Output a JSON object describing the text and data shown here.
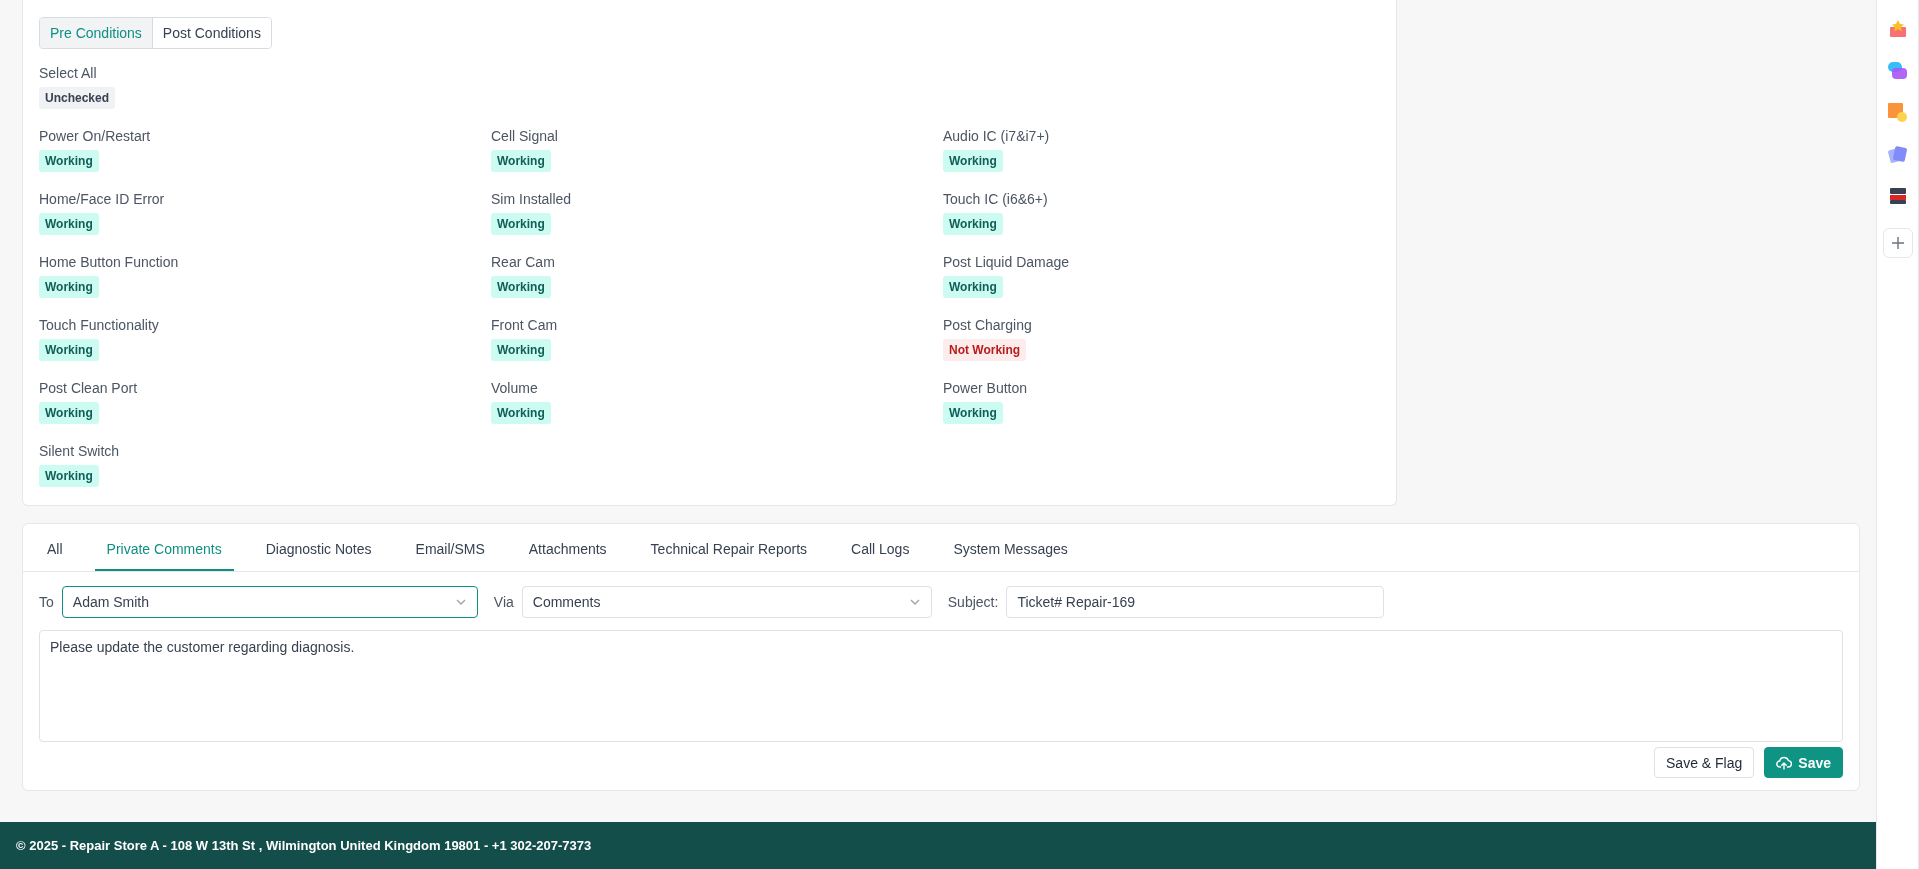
{
  "condition_tabs": [
    {
      "label": "Pre Conditions",
      "selected": true
    },
    {
      "label": "Post Conditions",
      "selected": false
    }
  ],
  "select_all": {
    "label": "Select All",
    "status": "Unchecked",
    "kind": "unchecked"
  },
  "conditions": [
    {
      "label": "Power On/Restart",
      "status": "Working",
      "kind": "working"
    },
    {
      "label": "Cell Signal",
      "status": "Working",
      "kind": "working"
    },
    {
      "label": "Audio IC (i7&i7+)",
      "status": "Working",
      "kind": "working"
    },
    {
      "label": "Home/Face ID Error",
      "status": "Working",
      "kind": "working"
    },
    {
      "label": "Sim Installed",
      "status": "Working",
      "kind": "working"
    },
    {
      "label": "Touch IC (i6&6+)",
      "status": "Working",
      "kind": "working"
    },
    {
      "label": "Home Button Function",
      "status": "Working",
      "kind": "working"
    },
    {
      "label": "Rear Cam",
      "status": "Working",
      "kind": "working"
    },
    {
      "label": "Post Liquid Damage",
      "status": "Working",
      "kind": "working"
    },
    {
      "label": "Touch Functionality",
      "status": "Working",
      "kind": "working"
    },
    {
      "label": "Front Cam",
      "status": "Working",
      "kind": "working"
    },
    {
      "label": "Post Charging",
      "status": "Not Working",
      "kind": "not_working"
    },
    {
      "label": "Post Clean Port",
      "status": "Working",
      "kind": "working"
    },
    {
      "label": "Volume",
      "status": "Working",
      "kind": "working"
    },
    {
      "label": "Power Button",
      "status": "Working",
      "kind": "working"
    },
    {
      "label": "Silent Switch",
      "status": "Working",
      "kind": "working"
    }
  ],
  "comment_tabs": [
    {
      "label": "All",
      "selected": false
    },
    {
      "label": "Private Comments",
      "selected": true
    },
    {
      "label": "Diagnostic Notes",
      "selected": false
    },
    {
      "label": "Email/SMS",
      "selected": false
    },
    {
      "label": "Attachments",
      "selected": false
    },
    {
      "label": "Technical Repair Reports",
      "selected": false
    },
    {
      "label": "Call Logs",
      "selected": false
    },
    {
      "label": "System Messages",
      "selected": false
    }
  ],
  "comment_form": {
    "to_label": "To",
    "to_value": "Adam Smith",
    "via_label": "Via",
    "via_value": "Comments",
    "subject_label": "Subject:",
    "subject_value": "Ticket# Repair-169",
    "message": "Please update the customer regarding diagnosis.",
    "buttons": [
      {
        "label": "Save & Flag",
        "kind": "secondary"
      },
      {
        "label": "Save",
        "kind": "primary"
      }
    ]
  },
  "footer": {
    "text": "© 2025 - Repair Store A - 108 W 13th St , Wilmington United Kingdom 19801 - +1 302-207-7373"
  }
}
